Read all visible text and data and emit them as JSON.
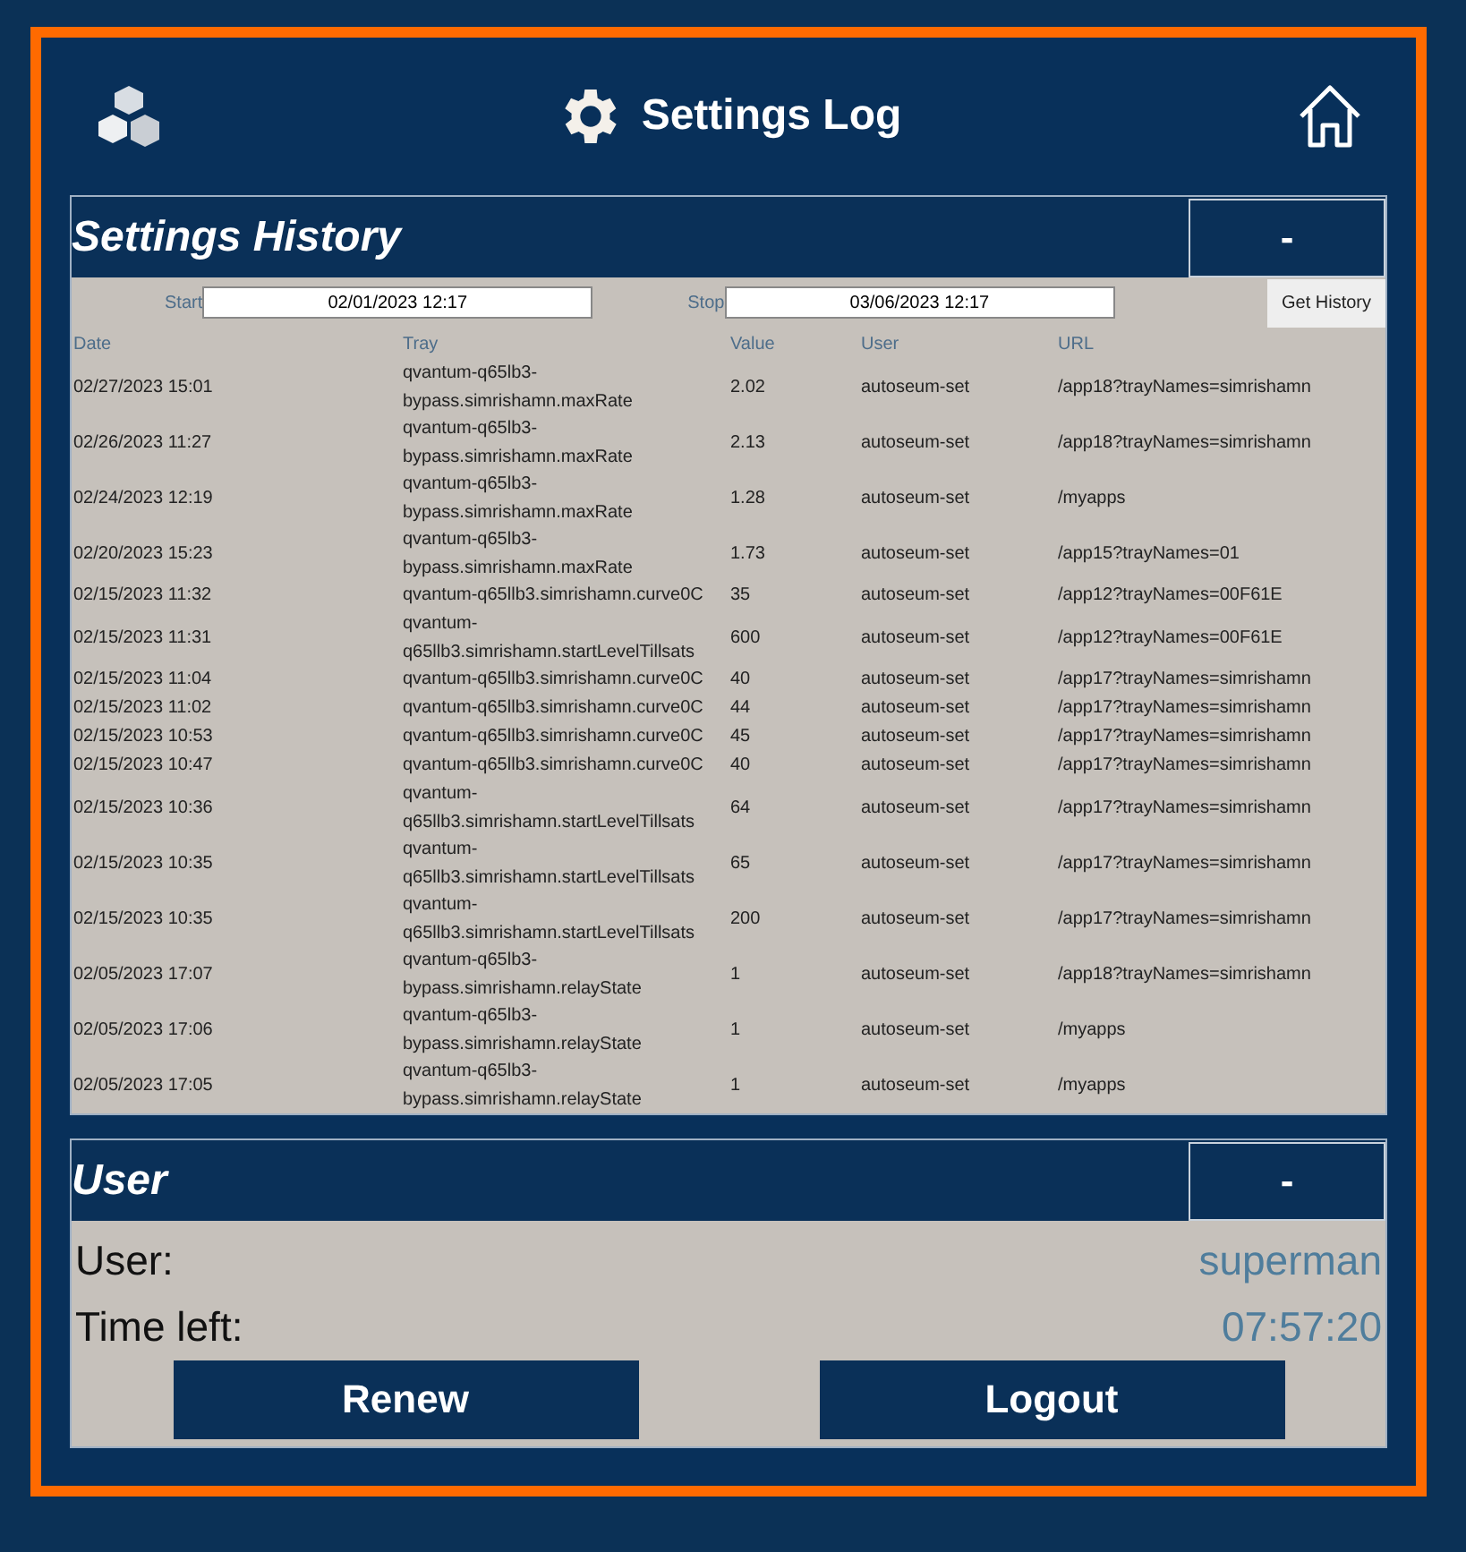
{
  "header": {
    "title": "Settings Log"
  },
  "history": {
    "title": "Settings History",
    "toggle": "-",
    "start_label": "Start",
    "start": "02/01/2023 12:17",
    "stop_label": "Stop",
    "stop": "03/06/2023 12:17",
    "button": "Get History",
    "columns": [
      "Date",
      "Tray",
      "Value",
      "User",
      "URL"
    ],
    "rows": [
      [
        "02/27/2023 15:01",
        "qvantum-q65lb3-bypass.simrishamn.maxRate",
        "2.02",
        "autoseum-set",
        "/app18?trayNames=simrishamn"
      ],
      [
        "02/26/2023 11:27",
        "qvantum-q65lb3-bypass.simrishamn.maxRate",
        "2.13",
        "autoseum-set",
        "/app18?trayNames=simrishamn"
      ],
      [
        "02/24/2023 12:19",
        "qvantum-q65lb3-bypass.simrishamn.maxRate",
        "1.28",
        "autoseum-set",
        "/myapps"
      ],
      [
        "02/20/2023 15:23",
        "qvantum-q65lb3-bypass.simrishamn.maxRate",
        "1.73",
        "autoseum-set",
        "/app15?trayNames=01"
      ],
      [
        "02/15/2023 11:32",
        "qvantum-q65llb3.simrishamn.curve0C",
        "35",
        "autoseum-set",
        "/app12?trayNames=00F61E"
      ],
      [
        "02/15/2023 11:31",
        "qvantum-q65llb3.simrishamn.startLevelTillsats",
        "600",
        "autoseum-set",
        "/app12?trayNames=00F61E"
      ],
      [
        "02/15/2023 11:04",
        "qvantum-q65llb3.simrishamn.curve0C",
        "40",
        "autoseum-set",
        "/app17?trayNames=simrishamn"
      ],
      [
        "02/15/2023 11:02",
        "qvantum-q65llb3.simrishamn.curve0C",
        "44",
        "autoseum-set",
        "/app17?trayNames=simrishamn"
      ],
      [
        "02/15/2023 10:53",
        "qvantum-q65llb3.simrishamn.curve0C",
        "45",
        "autoseum-set",
        "/app17?trayNames=simrishamn"
      ],
      [
        "02/15/2023 10:47",
        "qvantum-q65llb3.simrishamn.curve0C",
        "40",
        "autoseum-set",
        "/app17?trayNames=simrishamn"
      ],
      [
        "02/15/2023 10:36",
        "qvantum-q65llb3.simrishamn.startLevelTillsats",
        "64",
        "autoseum-set",
        "/app17?trayNames=simrishamn"
      ],
      [
        "02/15/2023 10:35",
        "qvantum-q65llb3.simrishamn.startLevelTillsats",
        "65",
        "autoseum-set",
        "/app17?trayNames=simrishamn"
      ],
      [
        "02/15/2023 10:35",
        "qvantum-q65llb3.simrishamn.startLevelTillsats",
        "200",
        "autoseum-set",
        "/app17?trayNames=simrishamn"
      ],
      [
        "02/05/2023 17:07",
        "qvantum-q65lb3-bypass.simrishamn.relayState",
        "1",
        "autoseum-set",
        "/app18?trayNames=simrishamn"
      ],
      [
        "02/05/2023 17:06",
        "qvantum-q65lb3-bypass.simrishamn.relayState",
        "1",
        "autoseum-set",
        "/myapps"
      ],
      [
        "02/05/2023 17:05",
        "qvantum-q65lb3-bypass.simrishamn.relayState",
        "1",
        "autoseum-set",
        "/myapps"
      ]
    ]
  },
  "user": {
    "title": "User",
    "toggle": "-",
    "fields": [
      {
        "label": "User:",
        "value": "superman"
      },
      {
        "label": "Time left:",
        "value": "07:57:20"
      }
    ],
    "buttons": [
      "Renew",
      "Logout"
    ]
  }
}
